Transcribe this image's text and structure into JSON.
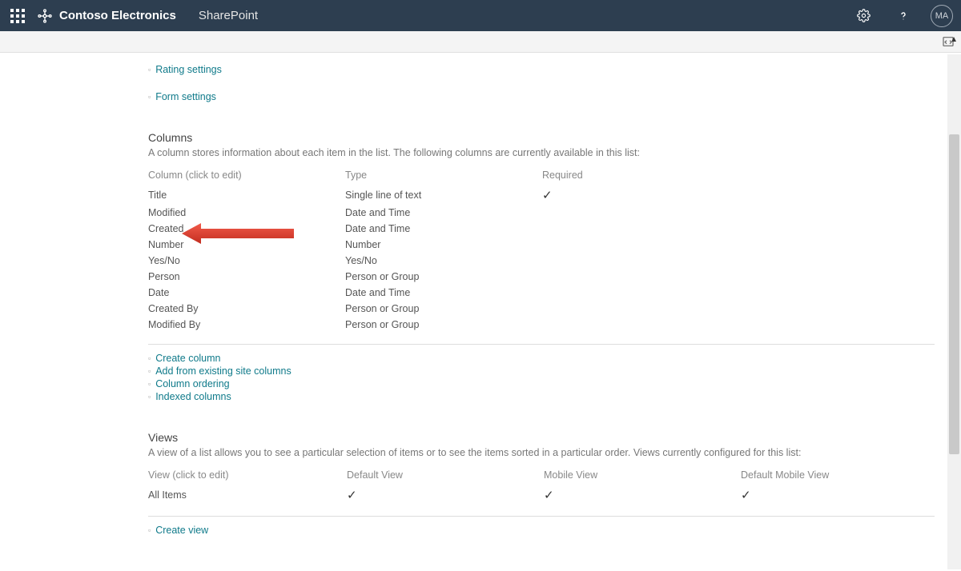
{
  "suite": {
    "tenant": "Contoso Electronics",
    "app": "SharePoint",
    "avatar_initials": "MA"
  },
  "top_links": [
    {
      "label": "Rating settings"
    },
    {
      "label": "Form settings"
    }
  ],
  "columns_section": {
    "heading": "Columns",
    "description": "A column stores information about each item in the list. The following columns are currently available in this list:",
    "header": {
      "name": "Column (click to edit)",
      "type": "Type",
      "required": "Required"
    },
    "rows": [
      {
        "name": "Title",
        "type": "Single line of text",
        "required": true
      },
      {
        "name": "Modified",
        "type": "Date and Time",
        "required": false
      },
      {
        "name": "Created",
        "type": "Date and Time",
        "required": false
      },
      {
        "name": "Number",
        "type": "Number",
        "required": false
      },
      {
        "name": "Yes/No",
        "type": "Yes/No",
        "required": false
      },
      {
        "name": "Person",
        "type": "Person or Group",
        "required": false
      },
      {
        "name": "Date",
        "type": "Date and Time",
        "required": false
      },
      {
        "name": "Created By",
        "type": "Person or Group",
        "required": false
      },
      {
        "name": "Modified By",
        "type": "Person or Group",
        "required": false
      }
    ],
    "action_links": [
      {
        "label": "Create column"
      },
      {
        "label": "Add from existing site columns"
      },
      {
        "label": "Column ordering"
      },
      {
        "label": "Indexed columns"
      }
    ]
  },
  "views_section": {
    "heading": "Views",
    "description": "A view of a list allows you to see a particular selection of items or to see the items sorted in a particular order. Views currently configured for this list:",
    "header": {
      "name": "View (click to edit)",
      "default": "Default View",
      "mobile": "Mobile View",
      "default_mobile": "Default Mobile View"
    },
    "rows": [
      {
        "name": "All Items",
        "default": true,
        "mobile": true,
        "default_mobile": true
      }
    ],
    "action_links": [
      {
        "label": "Create view"
      }
    ]
  }
}
